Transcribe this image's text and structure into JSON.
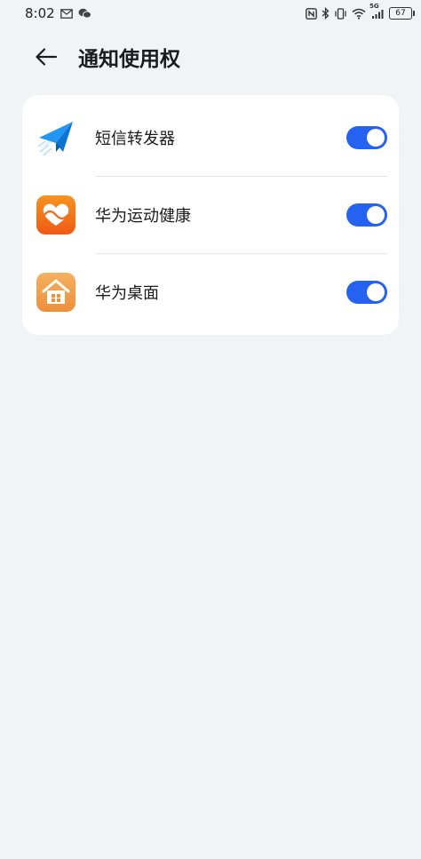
{
  "status_bar": {
    "time": "8:02",
    "battery": "67",
    "network": "5G",
    "icons": [
      "mail-icon",
      "wechat-icon",
      "nfc-icon",
      "bluetooth-icon",
      "vibrate-icon",
      "wifi-icon",
      "signal-icon",
      "battery-icon"
    ]
  },
  "header": {
    "title": "通知使用权",
    "back_icon": "arrow-left-icon"
  },
  "apps": [
    {
      "name": "短信转发器",
      "icon": "paper-plane-icon",
      "enabled": true
    },
    {
      "name": "华为运动健康",
      "icon": "heart-health-icon",
      "enabled": true
    },
    {
      "name": "华为桌面",
      "icon": "home-icon",
      "enabled": true
    }
  ],
  "colors": {
    "background": "#f1f3f5",
    "card": "#ffffff",
    "toggle_on": "#2562f0",
    "health_orange": "#f26b1d",
    "home_orange": "#f0a04b"
  }
}
